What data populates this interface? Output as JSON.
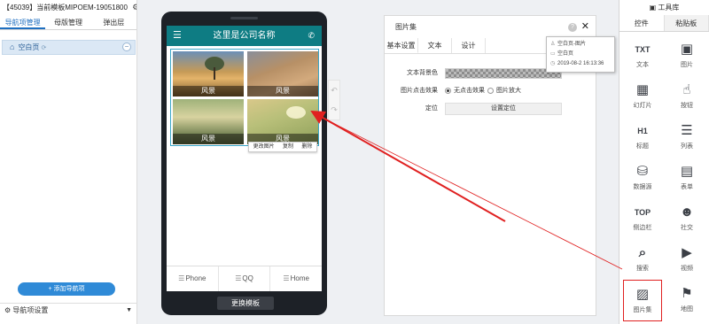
{
  "left": {
    "title": "【45039】当前模板MIPOEM-19051800",
    "tabs": [
      "导航项管理",
      "母版管理",
      "弹出层"
    ],
    "page_item": "空白页",
    "add_button": "+ 添加导航项",
    "nav_settings": "导航项设置"
  },
  "phone": {
    "title": "这里是公司名称",
    "tiles": [
      "风景",
      "风景",
      "风景",
      "风景"
    ],
    "context_menu": [
      "更改图片",
      "复制",
      "删除"
    ],
    "bottom_nav": [
      "Phone",
      "QQ",
      "Home"
    ],
    "change_template": "更换模板"
  },
  "props": {
    "title": "图片集",
    "tabs": [
      "基本设置",
      "文本",
      "设计"
    ],
    "bg_color_label": "文本背景色",
    "click_label": "图片点击效果",
    "click_options": [
      "无点击效果",
      "图片放大"
    ],
    "click_selected": 0,
    "position_label": "定位",
    "position_button": "设置定位"
  },
  "tooltip": {
    "lines": [
      "空白页-图片",
      "空白页",
      "2019-08-2 16:13:36"
    ]
  },
  "toolbox": {
    "title": "工具库",
    "tabs": [
      "控件",
      "粘贴板"
    ],
    "tools": [
      {
        "label": "文本",
        "icon": "text-icon",
        "glyph": "TXT"
      },
      {
        "label": "图片",
        "icon": "image-icon",
        "glyph": "▣"
      },
      {
        "label": "幻灯片",
        "icon": "slideshow-icon",
        "glyph": "▦"
      },
      {
        "label": "按钮",
        "icon": "button-icon",
        "glyph": "☝"
      },
      {
        "label": "标题",
        "icon": "heading-icon",
        "glyph": "H1"
      },
      {
        "label": "列表",
        "icon": "list-icon",
        "glyph": "☰"
      },
      {
        "label": "数据源",
        "icon": "database-icon",
        "glyph": "⛁"
      },
      {
        "label": "表单",
        "icon": "form-icon",
        "glyph": "▤"
      },
      {
        "label": "侧边栏",
        "icon": "sidebar-top-icon",
        "glyph": "TOP"
      },
      {
        "label": "社交",
        "icon": "social-icon",
        "glyph": "☻"
      },
      {
        "label": "搜索",
        "icon": "search-icon",
        "glyph": "⌕"
      },
      {
        "label": "视频",
        "icon": "video-icon",
        "glyph": "▶"
      },
      {
        "label": "图片集",
        "icon": "gallery-icon",
        "glyph": "▨"
      },
      {
        "label": "地图",
        "icon": "map-icon",
        "glyph": "⚑"
      }
    ],
    "highlighted": "图片集"
  },
  "colors": {
    "accent": "#1f6fc0",
    "appbar": "#0e7c83",
    "add_button": "#2f8ad7",
    "annotation_arrow": "#e02020"
  }
}
